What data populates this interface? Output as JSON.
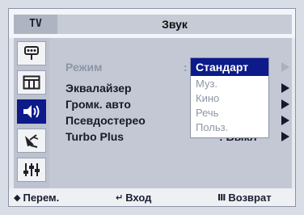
{
  "header": {
    "tv_tab": "TV",
    "title": "Звук"
  },
  "sidebar": {
    "items": [
      {
        "icon": "input-icon",
        "active": false
      },
      {
        "icon": "picture-icon",
        "active": false
      },
      {
        "icon": "sound-icon",
        "active": true
      },
      {
        "icon": "channel-icon",
        "active": false
      },
      {
        "icon": "setup-icon",
        "active": false
      }
    ]
  },
  "menu": {
    "rows": [
      {
        "label": "Режим",
        "value": ""
      },
      {
        "label": "Эквалайзер",
        "value": ""
      },
      {
        "label": "Громк. авто",
        "value": ""
      },
      {
        "label": "Псевдостерео",
        "value": ""
      },
      {
        "label": "Turbo Plus",
        "value": ": Выкл"
      }
    ],
    "colon": ":"
  },
  "dropdown": {
    "selected": "Стандарт",
    "options": [
      "Муз.",
      "Кино",
      "Речь",
      "Польз."
    ]
  },
  "footer": {
    "move_icon": "◆",
    "move_label": "Перем.",
    "enter_icon": "↵",
    "enter_label": "Вход",
    "return_icon": "Ⅲ",
    "return_label": "Возврат"
  },
  "colors": {
    "selection": "#0c1a8a",
    "panel": "#c3c8d4",
    "sidebar": "#bcc2cf",
    "dim_text": "#8e96a7"
  }
}
